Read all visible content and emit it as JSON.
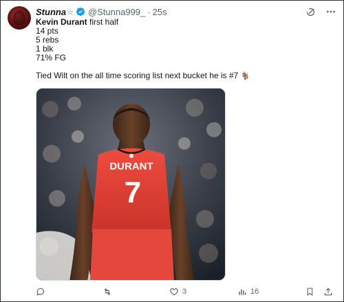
{
  "tweet": {
    "author": {
      "display_name": "Stunna",
      "name_suffix": "☆",
      "verified": true,
      "handle": "@Stunna999_",
      "separator": "·",
      "time": "25s"
    },
    "text": {
      "subject_bold": "Kevin Durant",
      "subject_rest": " first half",
      "stats": [
        "14 pts",
        "5 rebs",
        "1 blk",
        "71% FG"
      ],
      "comment": "Tied Wilt on the all time scoring list next bucket he is #7",
      "comment_emoji": "🐐"
    },
    "media": {
      "jersey_name": "DURANT",
      "jersey_number": "7",
      "jersey_color": "#e8473a"
    },
    "actions": {
      "reply_count": "",
      "retweet_count": "",
      "like_count": "3",
      "views_count": "16"
    }
  },
  "colors": {
    "text_primary": "#0f1419",
    "text_secondary": "#536471",
    "verified_blue": "#1d9bf0",
    "border": "#2f3336"
  },
  "icons": [
    "grok-icon",
    "more-icon",
    "reply-icon",
    "retweet-icon",
    "like-icon",
    "views-icon",
    "bookmark-icon",
    "share-icon"
  ]
}
